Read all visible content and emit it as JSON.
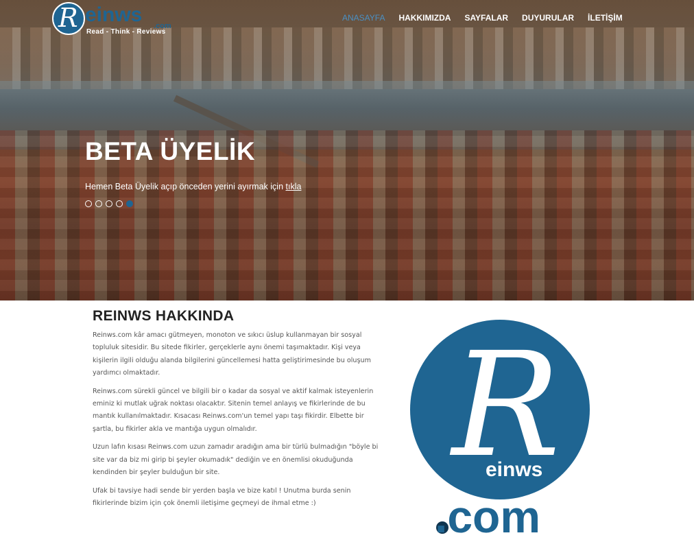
{
  "brand": {
    "logo_letter": "R",
    "logo_word": "einws",
    "logo_suffix": ".com",
    "tagline": "Read - Think - Reviews",
    "color": "#1f6592"
  },
  "nav": {
    "items": [
      {
        "label": "ANASAYFA",
        "active": true
      },
      {
        "label": "HAKKIMIZDA",
        "active": false
      },
      {
        "label": "SAYFALAR",
        "active": false
      },
      {
        "label": "DUYURULAR",
        "active": false
      },
      {
        "label": "İLETİŞİM",
        "active": false
      }
    ],
    "active_color": "#4a8fc2"
  },
  "hero": {
    "title": "BETA ÜYELİK",
    "subtitle": "Hemen Beta Üyelik açıp önceden yerini ayırmak için",
    "link_text": "tıkla",
    "slide_count": 5,
    "active_slide": 5
  },
  "about": {
    "title": "REINWS HAKKINDA",
    "paragraphs": [
      "Reinws.com kâr amacı gütmeyen, monoton ve sıkıcı üslup kullanmayan bir sosyal topluluk sitesidir. Bu sitede fikirler, gerçeklerle aynı önemi taşımaktadır. Kişi veya kişilerin ilgili olduğu alanda bilgilerini güncellemesi hatta geliştirimesinde bu oluşum yardımcı olmaktadır.",
      "Reinws.com sürekli güncel ve bilgili bir o kadar da sosyal ve aktif kalmak isteyenlerin eminiz ki mutlak uğrak noktası olacaktır. Sitenin temel anlayış ve fikirlerinde de bu mantık kullanılmaktadır. Kısacası Reinws.com'un temel yapı taşı fikirdir. Elbette bir şartla, bu fikirler akla ve mantığa uygun olmalıdır.",
      "Uzun lafın kısası Reinws.com uzun zamadır aradığın ama bir türlü bulmadığın \"böyle bi site var da biz mi girip bi şeyler okumadık\" dediğin ve en önemlisi okuduğunda kendinden bir şeyler bulduğun bir site.",
      "Ufak bi tavsiye hadi sende bir yerden başla ve bize katıl ! Unutma burda senin fikirlerinde bizim için çok önemli iletişime geçmeyi de ihmal etme :)"
    ]
  },
  "big_logo": {
    "letter": "R",
    "word": "einws",
    "suffix": ".com"
  }
}
